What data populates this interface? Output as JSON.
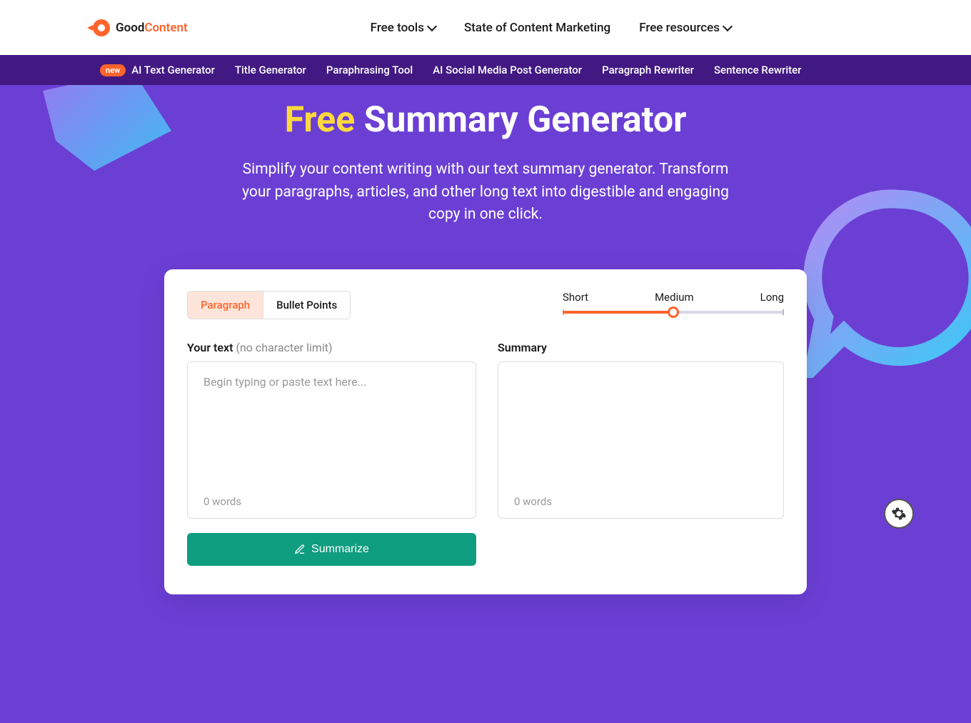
{
  "logo": {
    "good": "Good",
    "content": "Content"
  },
  "topNav": {
    "freeTools": "Free tools",
    "stateOfContent": "State of Content Marketing",
    "freeResources": "Free resources"
  },
  "subNav": {
    "newBadge": "new",
    "aiTextGenerator": "AI Text Generator",
    "titleGenerator": "Title Generator",
    "paraphrasingTool": "Paraphrasing Tool",
    "aiSocialMedia": "AI Social Media Post Generator",
    "paragraphRewriter": "Paragraph Rewriter",
    "sentenceRewriter": "Sentence Rewriter"
  },
  "hero": {
    "titleFree": "Free",
    "titleRest": " Summary Generator",
    "description": "Simplify your content writing with our text summary generator. Transform your paragraphs, articles, and other long text into digestible and engaging copy in one click."
  },
  "tabs": {
    "paragraph": "Paragraph",
    "bulletPoints": "Bullet Points"
  },
  "slider": {
    "short": "Short",
    "medium": "Medium",
    "long": "Long"
  },
  "input": {
    "label": "Your text",
    "hint": " (no character limit)",
    "placeholder": "Begin typing or paste text here...",
    "wordCount": "0 words"
  },
  "output": {
    "label": "Summary",
    "wordCount": "0 words"
  },
  "summarizeBtn": "Summarize"
}
